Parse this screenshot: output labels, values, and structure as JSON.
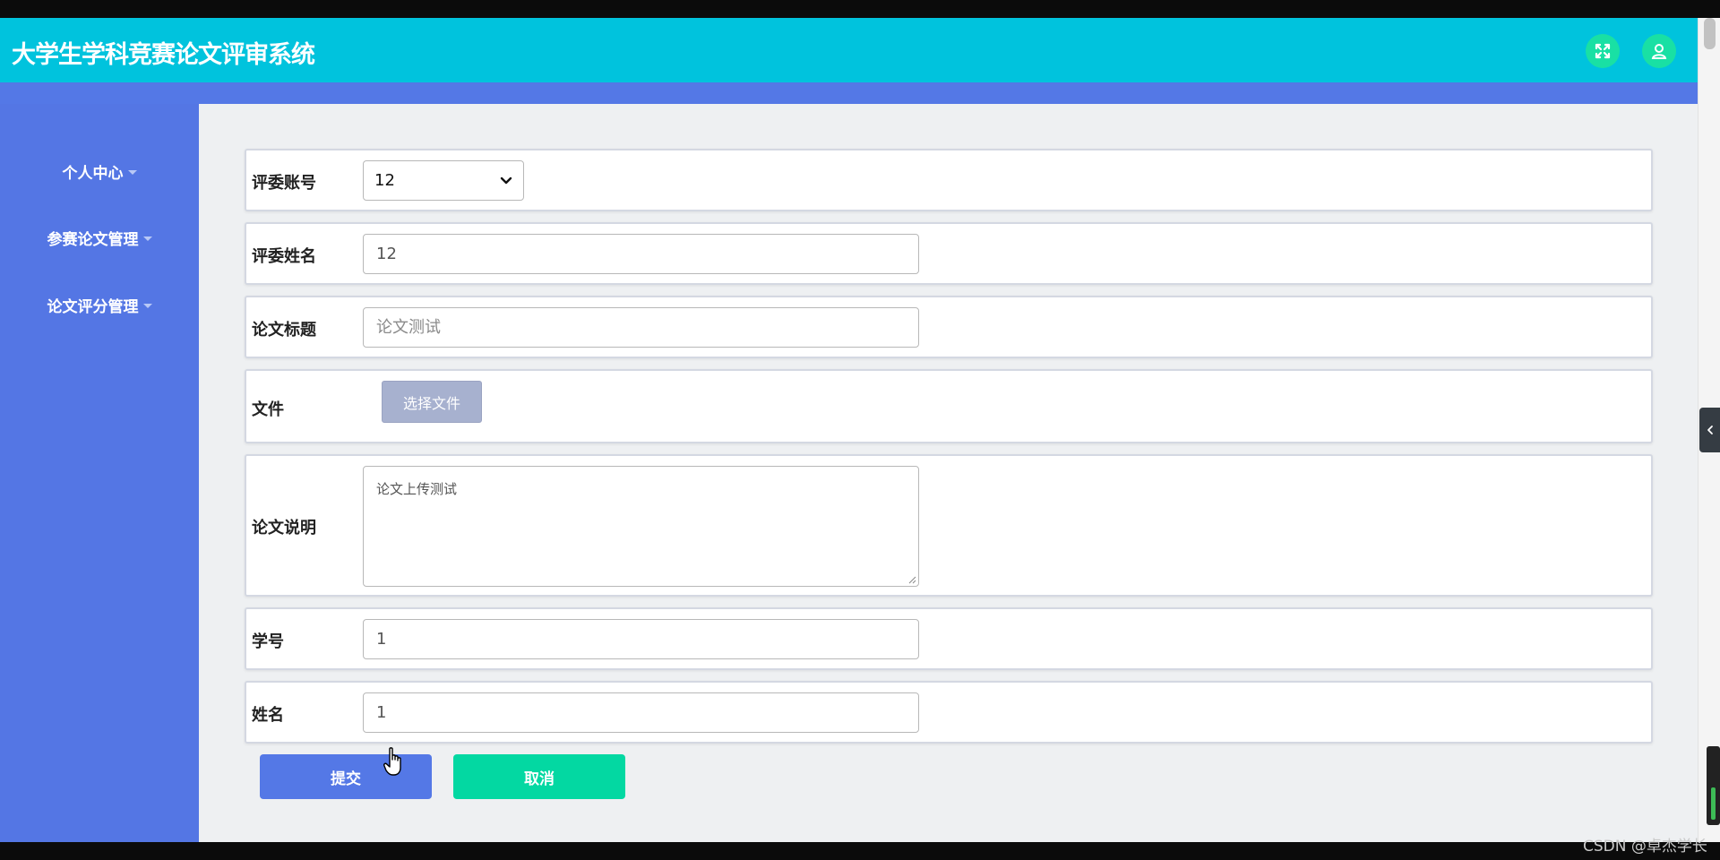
{
  "app_title": "大学生学科竞赛论文评审系统",
  "icons": {
    "fullscreen": "fullscreen-icon",
    "user": "user-icon",
    "collapse": "chevron-left-icon"
  },
  "colors": {
    "header": "#00c3dd",
    "sidebar": "#5476e4",
    "round_button": "#19e0a4",
    "submit": "#5478e6",
    "cancel": "#03d8a2"
  },
  "sidebar": {
    "items": [
      {
        "label": "个人中心"
      },
      {
        "label": "参赛论文管理"
      },
      {
        "label": "论文评分管理"
      }
    ]
  },
  "form": {
    "reviewer_account": {
      "label": "评委账号",
      "value": "12"
    },
    "reviewer_name": {
      "label": "评委姓名",
      "value": "12"
    },
    "paper_title": {
      "label": "论文标题",
      "value": "论文测试"
    },
    "file": {
      "label": "文件",
      "button_label": "选择文件"
    },
    "paper_desc": {
      "label": "论文说明",
      "value": "论文上传测试"
    },
    "student_id": {
      "label": "学号",
      "value": "1"
    },
    "student_name": {
      "label": "姓名",
      "value": "1"
    }
  },
  "actions": {
    "submit_label": "提交",
    "cancel_label": "取消"
  },
  "watermark": "CSDN @卓杰学长"
}
